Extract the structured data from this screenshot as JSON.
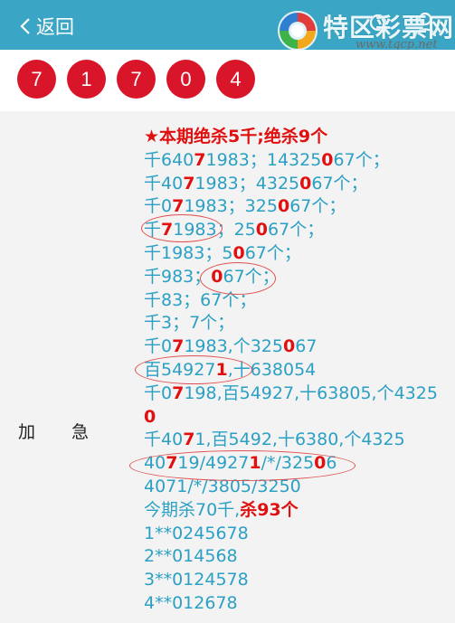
{
  "header": {
    "back_label": "返回",
    "logo_title": "特区彩票网",
    "logo_url": "www.tqcp.net",
    "bg_color": "#3aa5c4"
  },
  "balls": [
    "7",
    "1",
    "7",
    "0",
    "4"
  ],
  "ball_color": "#d9152a",
  "content": {
    "label_left": "加",
    "label_right": "急",
    "lines": [
      [
        {
          "t": "★本期绝杀5千",
          "r": 1
        },
        {
          "t": ";",
          "r": 0
        },
        {
          "t": "绝杀9个",
          "r": 1
        }
      ],
      [
        {
          "t": "千640",
          "r": 0
        },
        {
          "t": "7",
          "r": 1
        },
        {
          "t": "1983；14325",
          "r": 0
        },
        {
          "t": "0",
          "r": 1
        },
        {
          "t": "67个；",
          "r": 0
        }
      ],
      [
        {
          "t": "千40",
          "r": 0
        },
        {
          "t": "7",
          "r": 1
        },
        {
          "t": "1983；4325",
          "r": 0
        },
        {
          "t": "0",
          "r": 1
        },
        {
          "t": "67个；",
          "r": 0
        }
      ],
      [
        {
          "t": "千0",
          "r": 0
        },
        {
          "t": "7",
          "r": 1
        },
        {
          "t": "1983；325",
          "r": 0
        },
        {
          "t": "0",
          "r": 1
        },
        {
          "t": "67个；",
          "r": 0
        }
      ],
      [
        {
          "t": "千",
          "r": 0
        },
        {
          "t": "7",
          "r": 1
        },
        {
          "t": "1983；25",
          "r": 0
        },
        {
          "t": "0",
          "r": 1
        },
        {
          "t": "67个；",
          "r": 0
        }
      ],
      [
        {
          "t": "千1983；5",
          "r": 0
        },
        {
          "t": "0",
          "r": 1
        },
        {
          "t": "67个；",
          "r": 0
        }
      ],
      [
        {
          "t": "千983；",
          "r": 0
        },
        {
          "t": "0",
          "r": 1
        },
        {
          "t": "67个；",
          "r": 0
        }
      ],
      [
        {
          "t": "千83；67个；",
          "r": 0
        }
      ],
      [
        {
          "t": "千3；7个；",
          "r": 0
        }
      ],
      [
        {
          "t": "千0",
          "r": 0
        },
        {
          "t": "7",
          "r": 1
        },
        {
          "t": "1983,个325",
          "r": 0
        },
        {
          "t": "0",
          "r": 1
        },
        {
          "t": "67",
          "r": 0
        }
      ],
      [
        {
          "t": "百54927",
          "r": 0
        },
        {
          "t": "1",
          "r": 1
        },
        {
          "t": ",十638054",
          "r": 0
        }
      ],
      [
        {
          "t": "千0",
          "r": 0
        },
        {
          "t": "7",
          "r": 1
        },
        {
          "t": "198,百54927,十63805,个4325",
          "r": 0
        }
      ],
      [
        {
          "t": "0",
          "r": 1
        }
      ],
      [
        {
          "t": "千40",
          "r": 0
        },
        {
          "t": "7",
          "r": 1
        },
        {
          "t": "1,百5492,十6380,个4325",
          "r": 0
        }
      ],
      [
        {
          "t": "40",
          "r": 0
        },
        {
          "t": "7",
          "r": 1
        },
        {
          "t": "19/4927",
          "r": 0
        },
        {
          "t": "1",
          "r": 1
        },
        {
          "t": "/*/325",
          "r": 0
        },
        {
          "t": "0",
          "r": 1
        },
        {
          "t": "6",
          "r": 0
        }
      ],
      [
        {
          "t": "4071/*/3805/3250",
          "r": 0
        }
      ],
      [
        {
          "t": "今期杀70千,",
          "r": 0
        },
        {
          "t": "杀93个",
          "r": 1
        }
      ],
      [
        {
          "t": "1**0245678",
          "r": 0
        }
      ],
      [
        {
          "t": "2**014568",
          "r": 0
        }
      ],
      [
        {
          "t": "3**0124578",
          "r": 0
        }
      ],
      [
        {
          "t": "4**012678",
          "r": 0
        }
      ]
    ]
  }
}
